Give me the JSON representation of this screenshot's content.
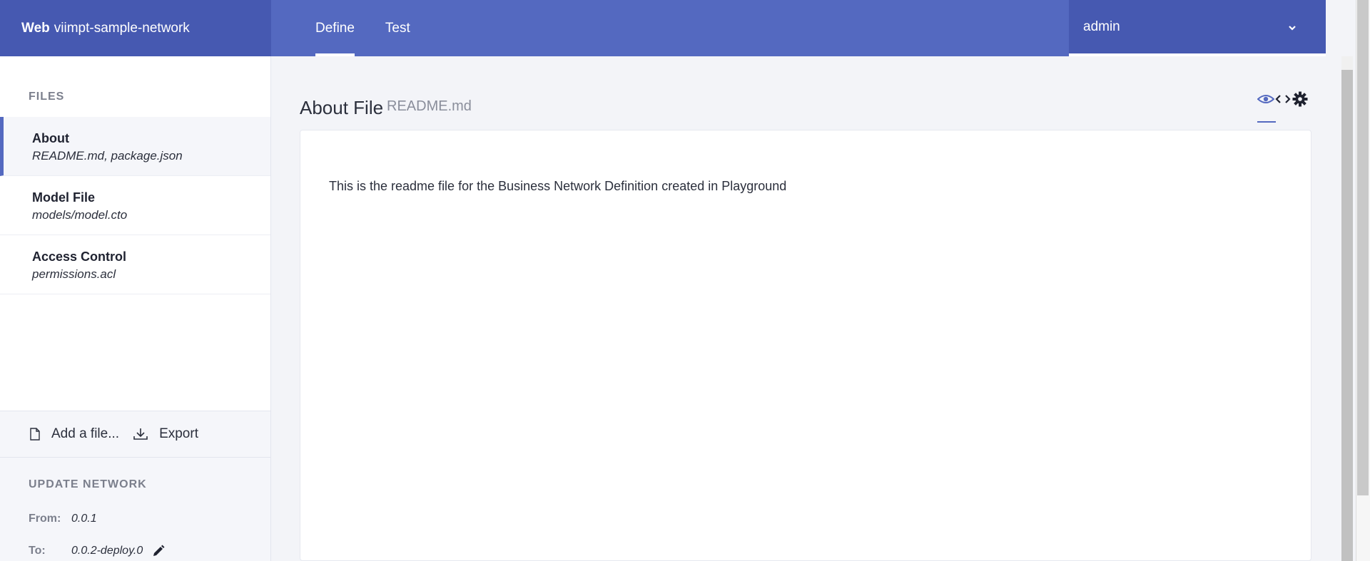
{
  "header": {
    "brand_bold": "Web",
    "brand_name": "viimpt-sample-network",
    "tabs": [
      {
        "label": "Define"
      },
      {
        "label": "Test"
      }
    ],
    "user": "admin"
  },
  "sidebar": {
    "files_title": "FILES",
    "files": [
      {
        "name": "About",
        "path": "README.md, package.json"
      },
      {
        "name": "Model File",
        "path": "models/model.cto"
      },
      {
        "name": "Access Control",
        "path": "permissions.acl"
      }
    ],
    "add_file_label": "Add a file...",
    "export_label": "Export",
    "update_title": "UPDATE NETWORK",
    "from_label": "From:",
    "from_value": "0.0.1",
    "to_label": "To:",
    "to_value": "0.0.2-deploy.0"
  },
  "main": {
    "title": "About File",
    "subtitle": "README.md",
    "content": "This is the readme file for the Business Network Definition created in Playground"
  },
  "colors": {
    "accent": "#5469c0",
    "brand_bg": "#4659b1"
  }
}
